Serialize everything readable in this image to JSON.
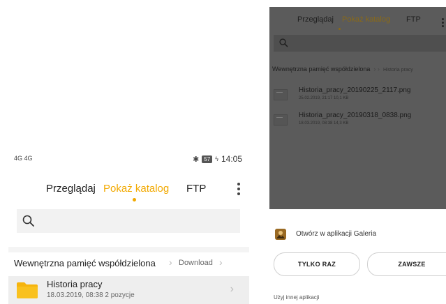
{
  "left": {
    "status": {
      "signal": "4G  4G",
      "battery": "57",
      "time": "14:05"
    },
    "tabs": [
      {
        "label": "Przeglądaj"
      },
      {
        "label": "Pokaż katalog"
      },
      {
        "label": "FTP"
      }
    ],
    "breadcrumb": {
      "root": "Wewnętrzna pamięć współdzielona",
      "current": "Download"
    },
    "folder": {
      "name": "Historia pracy",
      "meta": "18.03.2019, 08:38  2 pozycje"
    }
  },
  "right": {
    "tabs": [
      {
        "label": "Przeglądaj"
      },
      {
        "label": "Pokaż katalog"
      },
      {
        "label": "FTP"
      }
    ],
    "breadcrumb": {
      "root": "Wewnętrzna pamięć współdzielona",
      "current": "Historia pracy"
    },
    "files": [
      {
        "name": "Historia_pracy_20190225_2117.png",
        "meta": "25.02.2019, 21:17  10,1 KB"
      },
      {
        "name": "Historia_pracy_20190318_0838.png",
        "meta": "18.03.2019, 08:38  14,3 KB"
      }
    ],
    "sheet": {
      "open_with": "Otwórz w aplikacji Galeria",
      "once": "TYLKO RAZ",
      "always": "ZAWSZE",
      "other": "Użyj innej aplikacji"
    }
  },
  "colors": {
    "accent": "#f2a900",
    "dim_overlay": "#5b5b5b"
  },
  "icons": [
    "search-icon",
    "folder-icon",
    "bluetooth-icon",
    "battery-icon",
    "more-vert-icon",
    "chevron-right-icon",
    "gallery-app-icon",
    "image-file-icon"
  ]
}
